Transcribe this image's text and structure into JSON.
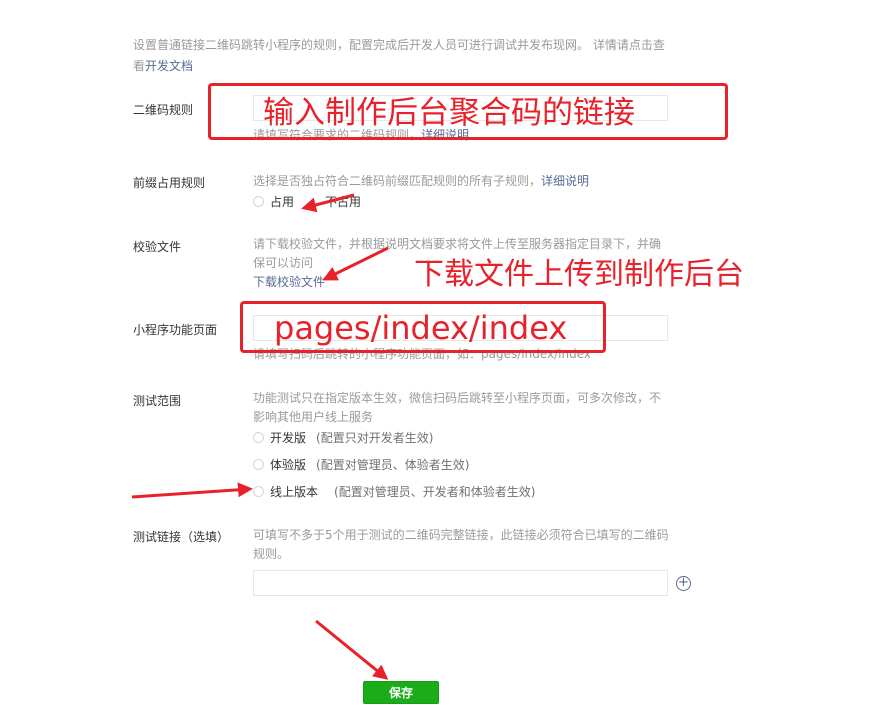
{
  "intro": {
    "text": "设置普通链接二维码跳转小程序的规则，配置完成后开发人员可进行调试并发布现网。 详情请点击查",
    "text2_prefix": "看",
    "link": "开发文档"
  },
  "qr_rule": {
    "label": "二维码规则",
    "value": "",
    "hint": "请填写符合要求的二维码规则，",
    "hint_link": "详细说明"
  },
  "prefix_rule": {
    "label": "前缀占用规则",
    "desc": "选择是否独占符合二维码前缀匹配规则的所有子规则，",
    "desc_link": "详细说明",
    "options": [
      "占用",
      "不占用"
    ]
  },
  "verify_file": {
    "label": "校验文件",
    "desc_line1": "请下载校验文件，并根据说明文档要求将文件上传至服务器指定目录下，并确",
    "desc_line2": "保可以访问",
    "link": "下载校验文件"
  },
  "page_path": {
    "label": "小程序功能页面",
    "value": "",
    "hint": "请填写扫码后跳转的小程序功能页面，如：pages/index/index"
  },
  "test_scope": {
    "label": "测试范围",
    "desc_line1": "功能测试只在指定版本生效，微信扫码后跳转至小程序页面，可多次修改，不",
    "desc_line2": "影响其他用户线上服务",
    "options": [
      {
        "name": "开发版",
        "note": "(配置只对开发者生效)"
      },
      {
        "name": "体验版",
        "note": "(配置对管理员、体验者生效)"
      },
      {
        "name": "线上版本",
        "note": "(配置对管理员、开发者和体验者生效)"
      }
    ]
  },
  "test_link": {
    "label": "测试链接（选填）",
    "desc_line1": "可填写不多于5个用于测试的二维码完整链接，此链接必须符合已填写的二维码",
    "desc_line2": "规则。",
    "value": ""
  },
  "save_label": "保存",
  "annotations": {
    "qr_box_text": "输入制作后台聚合码的链接",
    "download_text": "下载文件上传到制作后台",
    "path_box_text": "pages/index/index"
  },
  "colors": {
    "link": "#576b95",
    "primary_button": "#1aad19",
    "annotation_red": "#e8222b"
  }
}
